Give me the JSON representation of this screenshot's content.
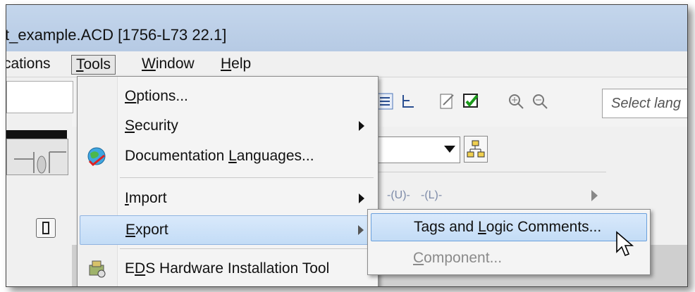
{
  "window": {
    "title": "t_example.ACD [1756-L73 22.1]"
  },
  "menubar": {
    "items": [
      {
        "label": "cations",
        "underline": ""
      },
      {
        "label": "Tools",
        "underline": "T",
        "active": true
      },
      {
        "label": "Window",
        "underline": "W"
      },
      {
        "label": "Help",
        "underline": "H"
      }
    ]
  },
  "toolbar": {
    "language_placeholder": "Select lang"
  },
  "ladder": {
    "instructions": [
      "-(U)-",
      "-(L)-"
    ]
  },
  "tools_menu": {
    "items": [
      {
        "pre": "",
        "u": "O",
        "post": "ptions...",
        "submenu": false
      },
      {
        "pre": "",
        "u": "S",
        "post": "ecurity",
        "submenu": true
      },
      {
        "pre": "Documentation ",
        "u": "L",
        "post": "anguages...",
        "submenu": false
      },
      {
        "pre": "",
        "u": "I",
        "post": "mport",
        "submenu": true
      },
      {
        "pre": "",
        "u": "E",
        "post": "xport",
        "submenu": true,
        "highlighted": true
      },
      {
        "pre": "E",
        "u": "D",
        "post": "S Hardware Installation Tool",
        "submenu": false
      }
    ]
  },
  "export_menu": {
    "items": [
      {
        "pre": "Tags and ",
        "u": "L",
        "post": "ogic Comments...",
        "highlighted": true
      },
      {
        "pre": "",
        "u": "C",
        "post": "omponent...",
        "disabled": true
      }
    ]
  },
  "colors": {
    "highlight": "#c3dcf6",
    "titlebar": "#b6cae4"
  }
}
